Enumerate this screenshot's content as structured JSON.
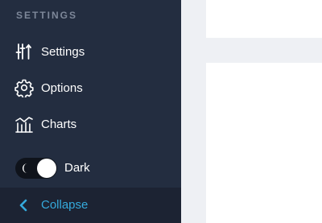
{
  "sidebar": {
    "section_title": "SETTINGS",
    "items": [
      {
        "label": "Settings",
        "icon": "sliders-icon"
      },
      {
        "label": "Options",
        "icon": "gear-icon"
      },
      {
        "label": "Charts",
        "icon": "chart-icon"
      }
    ],
    "theme_toggle": {
      "label": "Dark",
      "state": "on",
      "icon": "moon-icon"
    },
    "collapse": {
      "label": "Collapse",
      "icon": "chevron-left-icon"
    }
  },
  "colors": {
    "sidebar_bg": "#232d40",
    "collapse_bg": "#1c2333",
    "accent": "#35aadc",
    "section_title": "#7d8799",
    "content_bg": "#eef0f4",
    "card_bg": "#ffffff"
  }
}
